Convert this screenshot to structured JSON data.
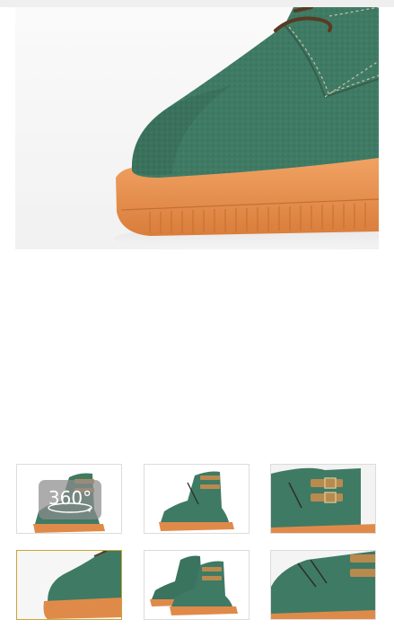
{
  "product": {
    "main_image": {
      "alt": "",
      "color": "#3f7a64",
      "sole_color": "#e08a4a"
    },
    "gallery": {
      "selected_index": 3,
      "thumbnails": [
        {
          "view": "side-360",
          "has_360": true
        },
        {
          "view": "side"
        },
        {
          "view": "buckle-closeup"
        },
        {
          "view": "toe-closeup"
        },
        {
          "view": "pair-side"
        },
        {
          "view": "angle-closeup"
        }
      ],
      "badge_360_label": "360°"
    }
  },
  "colors": {
    "leather": "#3f7a64",
    "sole": "#e08a4a",
    "buckle": "#b88a4e",
    "selected_border": "#c9a53a"
  }
}
